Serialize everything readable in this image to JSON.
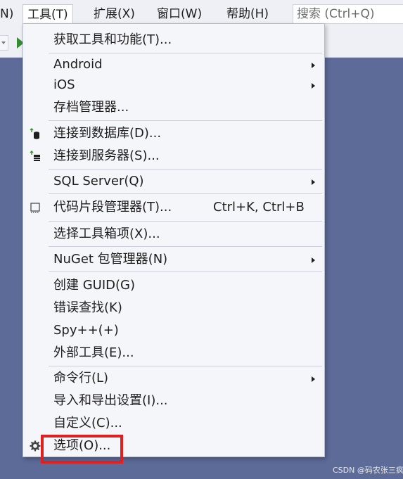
{
  "menubar": {
    "items": [
      {
        "label": "N)"
      },
      {
        "label": "工具(T)"
      },
      {
        "label": "扩展(X)"
      },
      {
        "label": "窗口(W)"
      },
      {
        "label": "帮助(H)"
      }
    ],
    "search_placeholder": "搜索 (Ctrl+Q)"
  },
  "tools_menu": {
    "items": [
      {
        "label": "获取工具和功能(T)..."
      },
      {
        "label": "Android"
      },
      {
        "label": "iOS"
      },
      {
        "label": "存档管理器..."
      },
      {
        "label": "连接到数据库(D)..."
      },
      {
        "label": "连接到服务器(S)..."
      },
      {
        "label": "SQL Server(Q)"
      },
      {
        "label": "代码片段管理器(T)...",
        "shortcut": "Ctrl+K, Ctrl+B"
      },
      {
        "label": "选择工具箱项(X)..."
      },
      {
        "label": "NuGet 包管理器(N)"
      },
      {
        "label": "创建 GUID(G)"
      },
      {
        "label": "错误查找(K)"
      },
      {
        "label": "Spy++(+)"
      },
      {
        "label": "外部工具(E)..."
      },
      {
        "label": "命令行(L)"
      },
      {
        "label": "导入和导出设置(I)..."
      },
      {
        "label": "自定义(C)..."
      },
      {
        "label": "选项(O)..."
      }
    ]
  },
  "icons": {
    "database": "database-connect-icon",
    "server": "server-connect-icon",
    "snippet": "code-snippet-icon",
    "options": "gear-icon"
  },
  "colors": {
    "highlight": "#e02020",
    "background": "#5d6b99"
  },
  "watermark": "CSDN @码农张三疯"
}
